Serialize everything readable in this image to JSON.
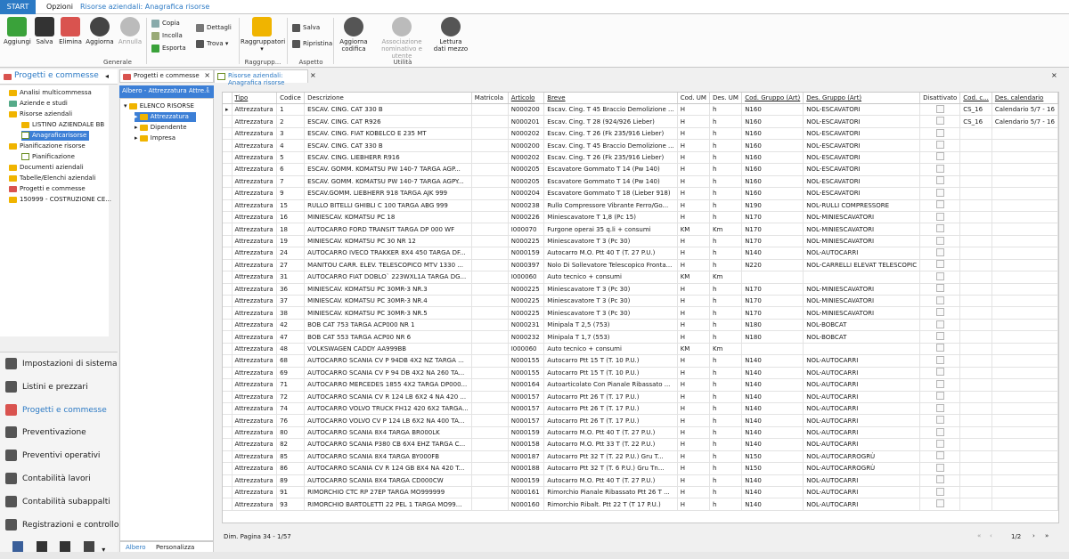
{
  "ribbon_tabs": [
    "START",
    "Opzioni",
    "Risorse aziendali: Anagrafica risorse"
  ],
  "ribbon": {
    "aggiungi": "Aggiungi",
    "salva": "Salva",
    "elimina": "Elimina",
    "aggiorna": "Aggiorna",
    "annulla": "Annulla",
    "copia": "Copia",
    "incolla": "Incolla",
    "esporta": "Esporta",
    "dettagli": "Dettagli",
    "trova": "Trova",
    "raggruppatori": "Raggruppatori",
    "salva2": "Salva",
    "ripristina": "Ripristina",
    "aggiorna_codifica": "Aggiorna\ncodifica",
    "associazione": "Associazione\nnominativo e utente",
    "lettura": "Lettura\ndati mezzo",
    "groups": [
      "Generale",
      "Raggrupp...",
      "Aspetto",
      "Utilità"
    ]
  },
  "nav": {
    "title": "Progetti e commesse",
    "tree": [
      "Analisi multicommessa",
      "Aziende e studi",
      "Risorse aziendali",
      "LISTINO AZIENDALE BB",
      "Anagraficarisorse",
      "Pianificazione risorse",
      "Pianificazione",
      "Documenti aziendali",
      "Tabelle/Elenchi aziendali",
      "Progetti e commesse",
      "150999 - COSTRUZIONE CE..."
    ],
    "list": [
      "Impostazioni di sistema",
      "Listini e prezzari",
      "Progetti e commesse",
      "Preventivazione",
      "Preventivi operativi",
      "Contabilità lavori",
      "Contabilità subappalti",
      "Registrazioni e controllo"
    ]
  },
  "mid": {
    "tab": "Progetti e commesse",
    "header": "Albero - Attrezzatura Attre...",
    "tree": [
      "ELENCO RISORSE",
      "Attrezzatura",
      "Dipendente",
      "Impresa"
    ],
    "foot": [
      "Albero",
      "Personalizza"
    ]
  },
  "main": {
    "tab": "Risorse aziendali: Anagrafica risorse",
    "columns": [
      "Tipo",
      "Codice",
      "Descrizione",
      "Matricola",
      "Articolo",
      "Breve",
      "Cod. UM",
      "Des. UM",
      "Cod. Gruppo (Art)",
      "Des. Gruppo (Art)",
      "Disattivato",
      "Cod. c...",
      "Des. calendario"
    ],
    "rows": [
      [
        "Attrezzatura",
        "1",
        "ESCAV. CING. CAT 330 B",
        "",
        "N000200",
        "Escav. Cing. T 45 Braccio Demolizione ...",
        "H",
        "h",
        "N160",
        "NOL-ESCAVATORI",
        "",
        "CS_16",
        "Calendario 5/7 - 16"
      ],
      [
        "Attrezzatura",
        "2",
        "ESCAV. CING. CAT R926",
        "",
        "N000201",
        "Escav. Cing. T 28 (924/926 Lieber)",
        "H",
        "h",
        "N160",
        "NOL-ESCAVATORI",
        "",
        "CS_16",
        "Calendario 5/7 - 16"
      ],
      [
        "Attrezzatura",
        "3",
        "ESCAV. CING. FIAT KOBELCO E 235 MT",
        "",
        "N000202",
        "Escav. Cing. T 26 (Fk 235/916 Lieber)",
        "H",
        "h",
        "N160",
        "NOL-ESCAVATORI",
        "",
        "",
        ""
      ],
      [
        "Attrezzatura",
        "4",
        "ESCAV. CING. CAT 330 B",
        "",
        "N000200",
        "Escav. Cing. T 45 Braccio Demolizione ...",
        "H",
        "h",
        "N160",
        "NOL-ESCAVATORI",
        "",
        "",
        ""
      ],
      [
        "Attrezzatura",
        "5",
        "ESCAV. CING. LIEBHERR R916",
        "",
        "N000202",
        "Escav. Cing. T 26 (Fk 235/916 Lieber)",
        "H",
        "h",
        "N160",
        "NOL-ESCAVATORI",
        "",
        "",
        ""
      ],
      [
        "Attrezzatura",
        "6",
        "ESCAV. GOMM. KOMATSU PW 140-7 TARGA AGP...",
        "",
        "N000205",
        "Escavatore Gommato T 14 (Pw 140)",
        "H",
        "h",
        "N160",
        "NOL-ESCAVATORI",
        "",
        "",
        ""
      ],
      [
        "Attrezzatura",
        "7",
        "ESCAV. GOMM. KOMATSU PW 140-7 TARGA AGPY...",
        "",
        "N000205",
        "Escavatore Gommato T 14 (Pw 140)",
        "H",
        "h",
        "N160",
        "NOL-ESCAVATORI",
        "",
        "",
        ""
      ],
      [
        "Attrezzatura",
        "9",
        "ESCAV.GOMM. LIEBHERR 918 TARGA AJK 999",
        "",
        "N000204",
        "Escavatore Gommato T 18 (Lieber 918)",
        "H",
        "h",
        "N160",
        "NOL-ESCAVATORI",
        "",
        "",
        ""
      ],
      [
        "Attrezzatura",
        "15",
        "RULLO BITELLI GHIBLI C 100 TARGA ABG 999",
        "",
        "N000238",
        "Rullo Compressore Vibrante Ferro/Go...",
        "H",
        "h",
        "N190",
        "NOL-RULLI COMPRESSORE",
        "",
        "",
        ""
      ],
      [
        "Attrezzatura",
        "16",
        "MINIESCAV. KOMATSU PC 18",
        "",
        "N000226",
        "Miniescavatore T 1,8 (Pc 15)",
        "H",
        "h",
        "N170",
        "NOL-MINIESCAVATORI",
        "",
        "",
        ""
      ],
      [
        "Attrezzatura",
        "18",
        "AUTOCARRO FORD TRANSIT TARGA DP 000 WF",
        "",
        "I000070",
        "Furgone operai 35 q.li + consumi",
        "KM",
        "Km",
        "N170",
        "NOL-MINIESCAVATORI",
        "",
        "",
        ""
      ],
      [
        "Attrezzatura",
        "19",
        "MINIESCAV. KOMATSU PC 30 NR 12",
        "",
        "N000225",
        "Miniescavatore T 3 (Pc 30)",
        "H",
        "h",
        "N170",
        "NOL-MINIESCAVATORI",
        "",
        "",
        ""
      ],
      [
        "Attrezzatura",
        "24",
        "AUTOCARRO IVECO TRAKKER 8X4 450 TARGA DF...",
        "",
        "N000159",
        "Autocarro M.O. Ptt 40 T (T. 27 P.U.)",
        "H",
        "h",
        "N140",
        "NOL-AUTOCARRI",
        "",
        "",
        ""
      ],
      [
        "Attrezzatura",
        "27",
        "MANITOU CARR. ELEV. TELESCOPICO MTV 1330 ...",
        "",
        "N000397",
        "Nolo Di Sollevatore Telescopico Fronta...",
        "H",
        "h",
        "N220",
        "NOL-CARRELLI ELEVAT TELESCOPIC",
        "",
        "",
        ""
      ],
      [
        "Attrezzatura",
        "31",
        "AUTOCARRO FIAT DOBLO` 223WXL1A TARGA DG...",
        "",
        "I000060",
        "Auto tecnico + consumi",
        "KM",
        "Km",
        "",
        "",
        "",
        "",
        ""
      ],
      [
        "Attrezzatura",
        "36",
        "MINIESCAV. KOMATSU PC 30MR-3 NR.3",
        "",
        "N000225",
        "Miniescavatore T 3 (Pc 30)",
        "H",
        "h",
        "N170",
        "NOL-MINIESCAVATORI",
        "",
        "",
        ""
      ],
      [
        "Attrezzatura",
        "37",
        "MINIESCAV. KOMATSU PC 30MR-3 NR.4",
        "",
        "N000225",
        "Miniescavatore T 3 (Pc 30)",
        "H",
        "h",
        "N170",
        "NOL-MINIESCAVATORI",
        "",
        "",
        ""
      ],
      [
        "Attrezzatura",
        "38",
        "MINIESCAV. KOMATSU PC 30MR-3 NR.5",
        "",
        "N000225",
        "Miniescavatore T 3 (Pc 30)",
        "H",
        "h",
        "N170",
        "NOL-MINIESCAVATORI",
        "",
        "",
        ""
      ],
      [
        "Attrezzatura",
        "42",
        "BOB CAT 753 TARGA ACP000 NR 1",
        "",
        "N000231",
        "Minipala T 2,5 (753)",
        "H",
        "h",
        "N180",
        "NOL-BOBCAT",
        "",
        "",
        ""
      ],
      [
        "Attrezzatura",
        "47",
        "BOB CAT 553 TARGA ACP00 NR 6",
        "",
        "N000232",
        "Minipala T 1,7 (553)",
        "H",
        "h",
        "N180",
        "NOL-BOBCAT",
        "",
        "",
        ""
      ],
      [
        "Attrezzatura",
        "48",
        "VOLKSWAGEN CADDY AA999BB",
        "",
        "I000060",
        "Auto tecnico + consumi",
        "KM",
        "Km",
        "",
        "",
        "",
        "",
        ""
      ],
      [
        "Attrezzatura",
        "68",
        "AUTOCARRO SCANIA CV P 94DB 4X2 NZ TARGA ...",
        "",
        "N000155",
        "Autocarro Ptt 15 T (T. 10 P.U.)",
        "H",
        "h",
        "N140",
        "NOL-AUTOCARRI",
        "",
        "",
        ""
      ],
      [
        "Attrezzatura",
        "69",
        "AUTOCARRO SCANIA CV P 94 DB 4X2 NA 260 TA...",
        "",
        "N000155",
        "Autocarro Ptt 15 T (T. 10 P.U.)",
        "H",
        "h",
        "N140",
        "NOL-AUTOCARRI",
        "",
        "",
        ""
      ],
      [
        "Attrezzatura",
        "71",
        "AUTOCARRO MERCEDES 1855 4X2 TARGA DP000...",
        "",
        "N000164",
        "Autoarticolato Con Pianale Ribassato ...",
        "H",
        "h",
        "N140",
        "NOL-AUTOCARRI",
        "",
        "",
        ""
      ],
      [
        "Attrezzatura",
        "72",
        "AUTOCARRO SCANIA CV R 124 LB 6X2 4 NA 420 ...",
        "",
        "N000157",
        "Autocarro Ptt 26 T (T. 17 P.U.)",
        "H",
        "h",
        "N140",
        "NOL-AUTOCARRI",
        "",
        "",
        ""
      ],
      [
        "Attrezzatura",
        "74",
        "AUTOCARRO VOLVO TRUCK FH12 420 6X2 TARGA...",
        "",
        "N000157",
        "Autocarro Ptt 26 T (T. 17 P.U.)",
        "H",
        "h",
        "N140",
        "NOL-AUTOCARRI",
        "",
        "",
        ""
      ],
      [
        "Attrezzatura",
        "76",
        "AUTOCARRO VOLVO CV P 124 LB 6X2 NA 400 TA...",
        "",
        "N000157",
        "Autocarro Ptt 26 T (T. 17 P.U.)",
        "H",
        "h",
        "N140",
        "NOL-AUTOCARRI",
        "",
        "",
        ""
      ],
      [
        "Attrezzatura",
        "80",
        "AUTOCARRO SCANIA 8X4 TARGA BR000LK",
        "",
        "N000159",
        "Autocarro M.O. Ptt 40 T (T. 27 P.U.)",
        "H",
        "h",
        "N140",
        "NOL-AUTOCARRI",
        "",
        "",
        ""
      ],
      [
        "Attrezzatura",
        "82",
        "AUTOCARRO SCANIA P380 CB 6X4 EHZ TARGA C...",
        "",
        "N000158",
        "Autocarro M.O. Ptt 33 T (T. 22 P.U.)",
        "H",
        "h",
        "N140",
        "NOL-AUTOCARRI",
        "",
        "",
        ""
      ],
      [
        "Attrezzatura",
        "85",
        "AUTOCARRO SCANIA 8X4 TARGA BY000FB",
        "",
        "N000187",
        "Autocarro Ptt 32 T (T. 22 P.U.) Gru T...",
        "H",
        "h",
        "N150",
        "NOL-AUTOCARROGRÙ",
        "",
        "",
        ""
      ],
      [
        "Attrezzatura",
        "86",
        "AUTOCARRO SCANIA CV R 124 GB 8X4 NA 420 T...",
        "",
        "N000188",
        "Autocarro Ptt 32 T (T. 6 P.U.) Gru Tn...",
        "H",
        "h",
        "N150",
        "NOL-AUTOCARROGRÙ",
        "",
        "",
        ""
      ],
      [
        "Attrezzatura",
        "89",
        "AUTOCARRO SCANIA 8X4 TARGA CD000CW",
        "",
        "N000159",
        "Autocarro M.O. Ptt 40 T (T. 27 P.U.)",
        "H",
        "h",
        "N140",
        "NOL-AUTOCARRI",
        "",
        "",
        ""
      ],
      [
        "Attrezzatura",
        "91",
        "RIMORCHIO CTC RP 27EP  TARGA MO999999",
        "",
        "N000161",
        "Rimorchio Pianale Ribassato Ptt 26 T ...",
        "H",
        "h",
        "N140",
        "NOL-AUTOCARRI",
        "",
        "",
        ""
      ],
      [
        "Attrezzatura",
        "93",
        "RIMORCHIO BARTOLETTI 22 PEL 1 TARGA MO99...",
        "",
        "N000160",
        "Rimorchio Ribalt. Ptt 22 T (T 17 P.U.)",
        "H",
        "h",
        "N140",
        "NOL-AUTOCARRI",
        "",
        "",
        ""
      ]
    ],
    "status": "Dim. Pagina 34 - 1/57",
    "pager": "1/2"
  }
}
